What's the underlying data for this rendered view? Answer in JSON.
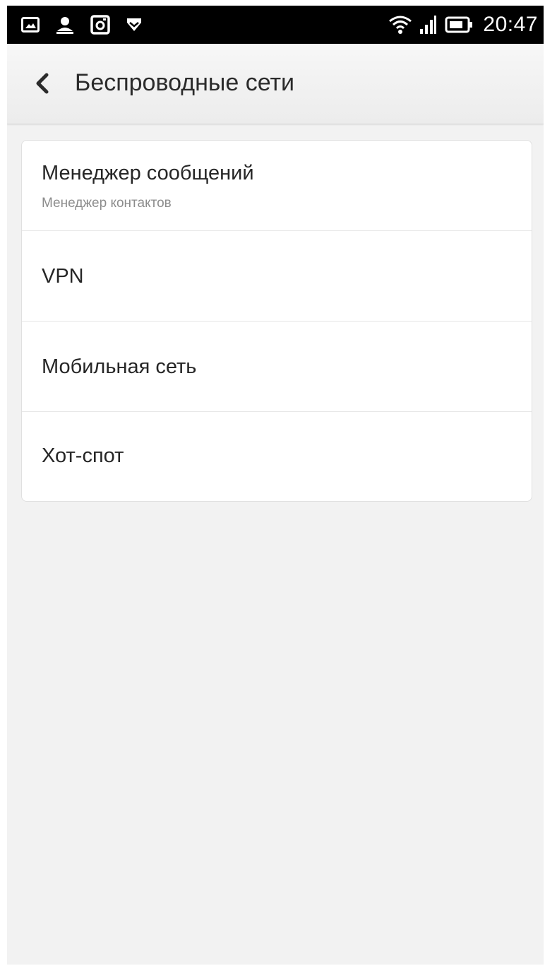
{
  "status_bar": {
    "left_icons": [
      "gallery-icon",
      "person-icon",
      "instagram-icon",
      "shield-icon"
    ],
    "right_icons": [
      "wifi-icon",
      "signal-icon",
      "battery-icon"
    ],
    "time": "20:47"
  },
  "header": {
    "back_icon": "chevron-left-icon",
    "title": "Беспроводные сети"
  },
  "settings_list": {
    "items": [
      {
        "label": "Менеджер сообщений",
        "sublabel": "Менеджер контактов"
      },
      {
        "label": "VPN"
      },
      {
        "label": "Мобильная сеть"
      },
      {
        "label": "Хот-спот"
      }
    ]
  },
  "colors": {
    "status_bar_bg": "#000000",
    "page_bg": "#f2f2f2",
    "card_bg": "#ffffff",
    "text_primary": "#262626",
    "text_secondary": "#8c8c8c"
  }
}
